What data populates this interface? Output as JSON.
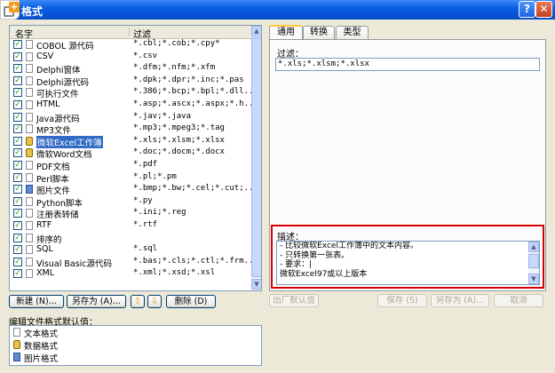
{
  "window": {
    "title": "格式"
  },
  "list": {
    "headers": {
      "name": "名字",
      "filter": "过滤"
    },
    "rows": [
      {
        "name": "COBOL 源代码",
        "filter": "*.cbl;*.cob;*.cpy*",
        "icon": "file-icon",
        "checked": true
      },
      {
        "name": "CSV",
        "filter": "*.csv",
        "icon": "file-icon",
        "checked": true
      },
      {
        "name": "Delphi窗体",
        "filter": "*.dfm;*.nfm;*.xfm",
        "icon": "file-icon",
        "checked": true
      },
      {
        "name": "Delphi源代码",
        "filter": "*.dpk;*.dpr;*.inc;*.pas",
        "icon": "file-icon",
        "checked": true
      },
      {
        "name": "可执行文件",
        "filter": "*.386;*.bcp;*.bpl;*.dll...",
        "icon": "executable-icon",
        "checked": true
      },
      {
        "name": "HTML",
        "filter": "*.asp;*.ascx;*.aspx;*.h...",
        "icon": "file-icon",
        "checked": true
      },
      {
        "name": "Java源代码",
        "filter": "*.jav;*.java",
        "icon": "file-icon",
        "checked": true
      },
      {
        "name": "MP3文件",
        "filter": "*.mp3;*.mpeg3;*.tag",
        "icon": "file-icon",
        "checked": true
      },
      {
        "name": "微软Excel工作簿",
        "filter": "*.xls;*.xlsm;*.xlsx",
        "icon": "database-icon",
        "checked": true,
        "selected": true
      },
      {
        "name": "微软Word文档",
        "filter": "*.doc;*.docm;*.docx",
        "icon": "database-icon",
        "checked": true
      },
      {
        "name": "PDF文档",
        "filter": "*.pdf",
        "icon": "file-icon",
        "checked": true
      },
      {
        "name": "Perl脚本",
        "filter": "*.pl;*.pm",
        "icon": "file-icon",
        "checked": true
      },
      {
        "name": "图片文件",
        "filter": "*.bmp;*.bw;*.cel;*.cut;...",
        "icon": "image-icon",
        "checked": true
      },
      {
        "name": "Python脚本",
        "filter": "*.py",
        "icon": "file-icon",
        "checked": true
      },
      {
        "name": "注册表转储",
        "filter": "*.ini;*.reg",
        "icon": "file-icon",
        "checked": true
      },
      {
        "name": "RTF",
        "filter": "*.rtf",
        "icon": "file-icon",
        "checked": true
      },
      {
        "name": "排序的",
        "filter": "",
        "icon": "file-icon",
        "checked": true
      },
      {
        "name": "SQL",
        "filter": "*.sql",
        "icon": "file-icon",
        "checked": true
      },
      {
        "name": "Visual Basic源代码",
        "filter": "*.bas;*.cls;*.ctl;*.frm...",
        "icon": "file-icon",
        "checked": true
      },
      {
        "name": "XML",
        "filter": "*.xml;*.xsd;*.xsl",
        "icon": "file-icon",
        "checked": true
      }
    ]
  },
  "left_buttons": {
    "new": "新建 (N)...",
    "save_as": "另存为 (A)...",
    "up": "⇧",
    "down": "⇩",
    "delete": "删除 (D)"
  },
  "defaults": {
    "label": "编辑文件格式默认值：",
    "items": [
      {
        "text": "文本格式",
        "icon": "file-icon"
      },
      {
        "text": "数据格式",
        "icon": "database-icon"
      },
      {
        "text": "图片格式",
        "icon": "image-icon"
      }
    ]
  },
  "tabs": {
    "general": "通用",
    "convert": "转换",
    "type": "类型"
  },
  "panel": {
    "filter_label": "过滤：",
    "filter_value": "*.xls;*.xlsm;*.xlsx",
    "desc_label": "描述：",
    "desc_lines": [
      "- 比较微软Excel工作簿中的文本内容。",
      "- 只转换第一张表。",
      "- 要求：|",
      "      微软Excel97或以上版本"
    ]
  },
  "right_buttons": {
    "factory": "出厂默认值",
    "save": "保存 (S)",
    "save_as": "另存为 (A)...",
    "cancel": "取消"
  }
}
